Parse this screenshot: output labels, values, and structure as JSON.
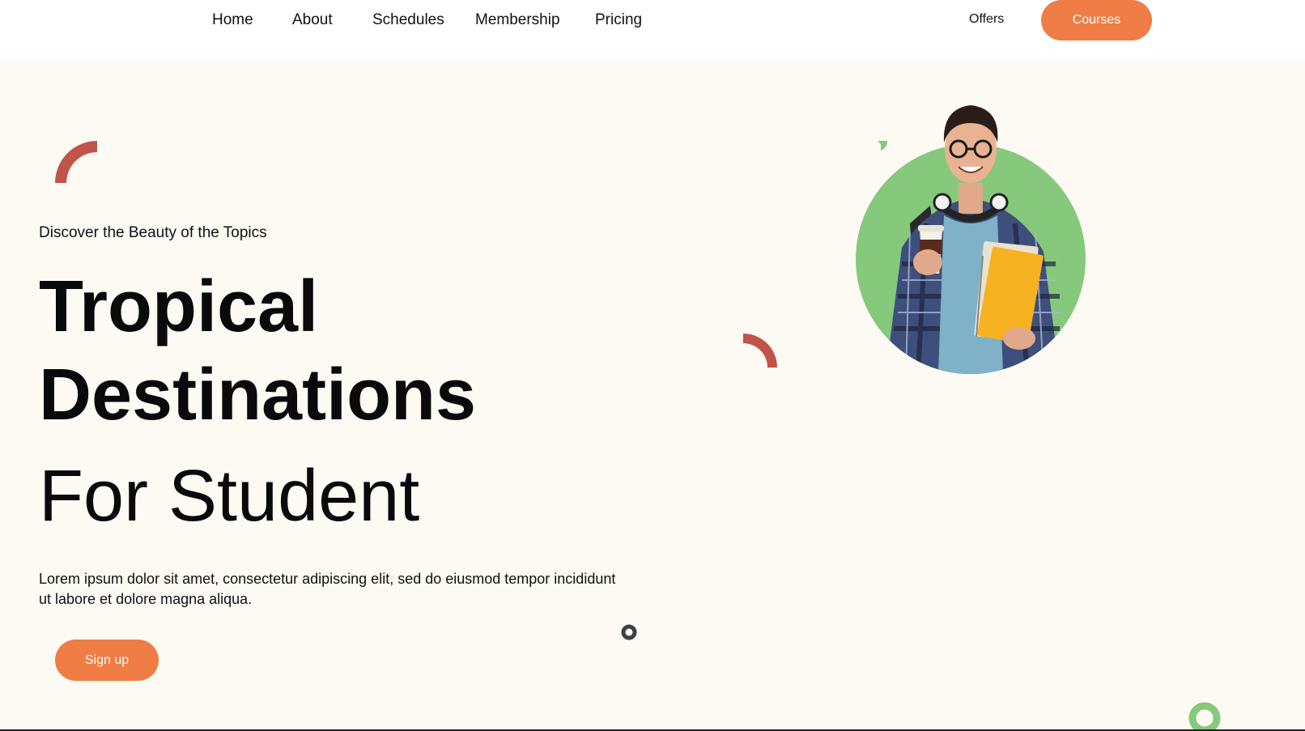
{
  "nav": {
    "items": [
      "Home",
      "About",
      "Schedules",
      "Membership",
      "Pricing"
    ],
    "offers_label": "Offers",
    "courses_label": "Courses"
  },
  "hero": {
    "kicker": "Discover the Beauty of the Topics",
    "title_line1": "Tropical",
    "title_line2": "Destinations",
    "subtitle": "For Student",
    "description": "Lorem ipsum dolor sit amet, consectetur adipiscing elit, sed do eiusmod tempor incididunt ut labore et dolore magna aliqua.",
    "signup_label": "Sign up"
  },
  "colors": {
    "accent": "#f07d45",
    "background": "#fdfaf4",
    "arc_red": "#c0544a",
    "green": "#86c97c",
    "dark": "#3a4145"
  },
  "icons": [
    "arc-decoration",
    "ring-decoration",
    "student-portrait"
  ]
}
